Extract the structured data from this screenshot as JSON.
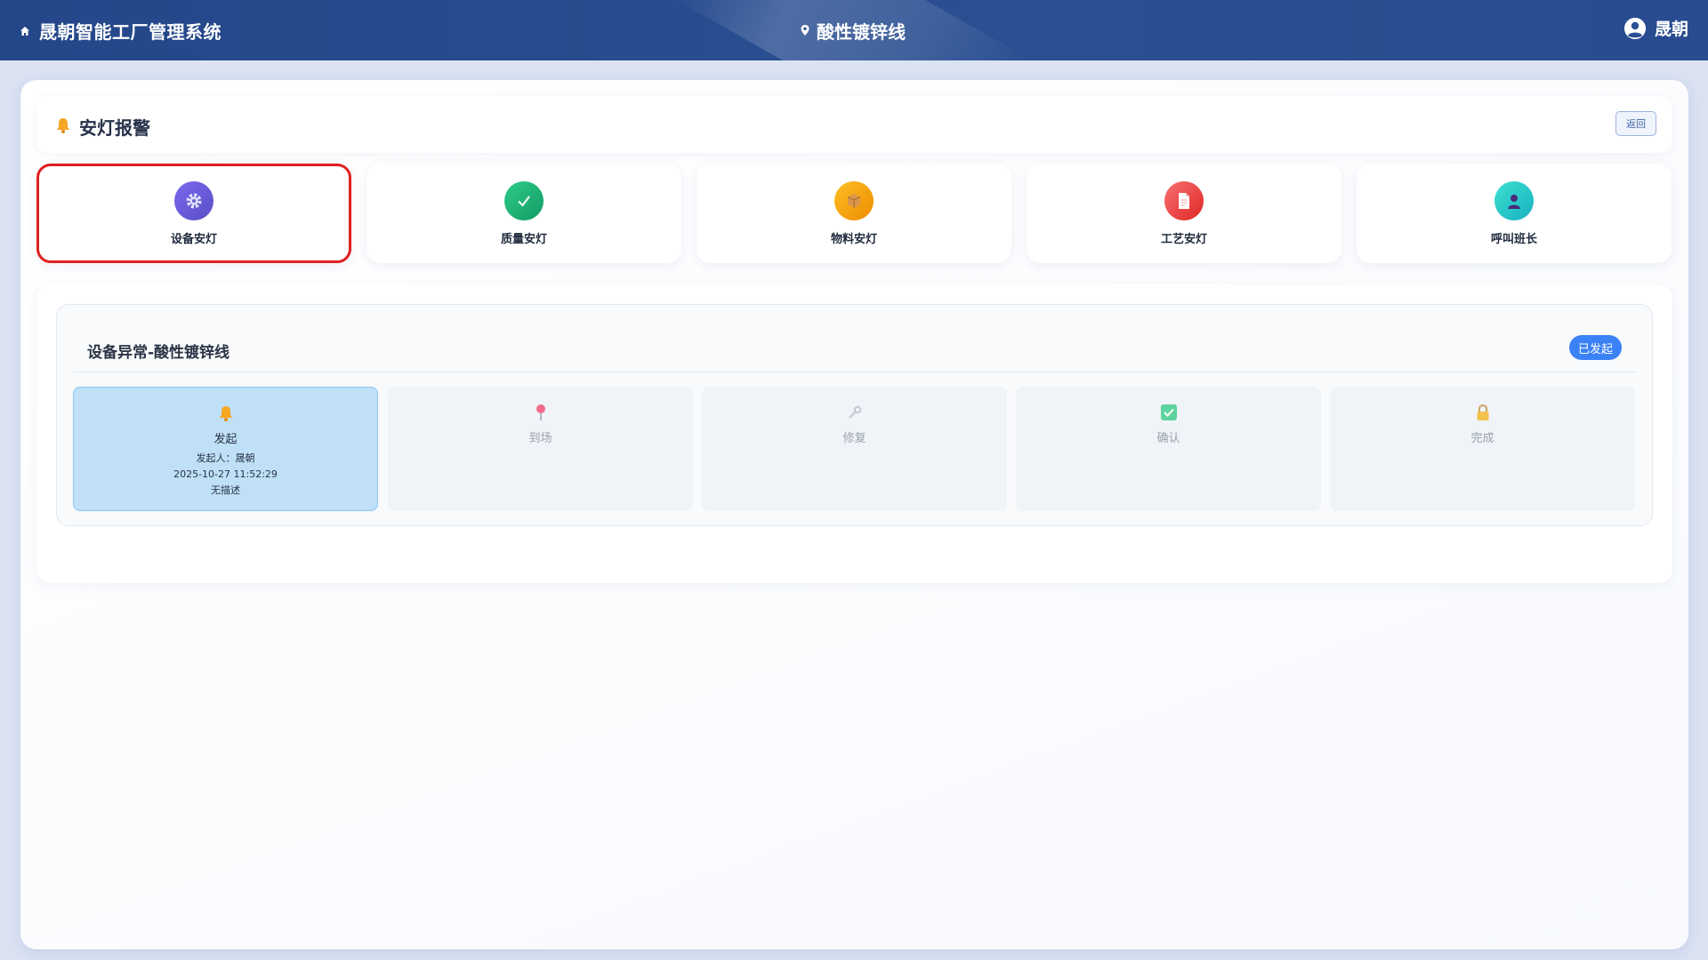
{
  "header": {
    "app_title": "晟朝智能工厂管理系统",
    "line_name": "酸性镀锌线",
    "user_name": "晟朝",
    "icons": {
      "home": "home-icon",
      "location": "location-pin-icon",
      "user": "user-avatar-icon"
    }
  },
  "page": {
    "title": "安灯报警",
    "title_icon": "bell-icon",
    "back_label": "返回"
  },
  "categories": [
    {
      "label": "设备安灯",
      "icon": "gear-icon",
      "color": "#6a5acd",
      "selected": true
    },
    {
      "label": "质量安灯",
      "icon": "check-icon",
      "color": "#1fb47a",
      "selected": false
    },
    {
      "label": "物料安灯",
      "icon": "box-icon",
      "color": "#f5a40c",
      "selected": false
    },
    {
      "label": "工艺安灯",
      "icon": "document-icon",
      "color": "#f04444",
      "selected": false
    },
    {
      "label": "呼叫班长",
      "icon": "person-icon",
      "color": "#2cc7c0",
      "selected": false
    }
  ],
  "flow": {
    "title": "设备异常-酸性镀锌线",
    "status": "已发起",
    "steps": [
      {
        "label": "发起",
        "icon": "bell-icon",
        "active": true,
        "initiator": "发起人：晟朝",
        "time": "2025-10-27 11:52:29",
        "desc": "无描述"
      },
      {
        "label": "到场",
        "icon": "pin-icon",
        "active": false
      },
      {
        "label": "修复",
        "icon": "wrench-icon",
        "active": false
      },
      {
        "label": "确认",
        "icon": "checkbox-icon",
        "active": false
      },
      {
        "label": "完成",
        "icon": "lock-icon",
        "active": false
      }
    ]
  }
}
